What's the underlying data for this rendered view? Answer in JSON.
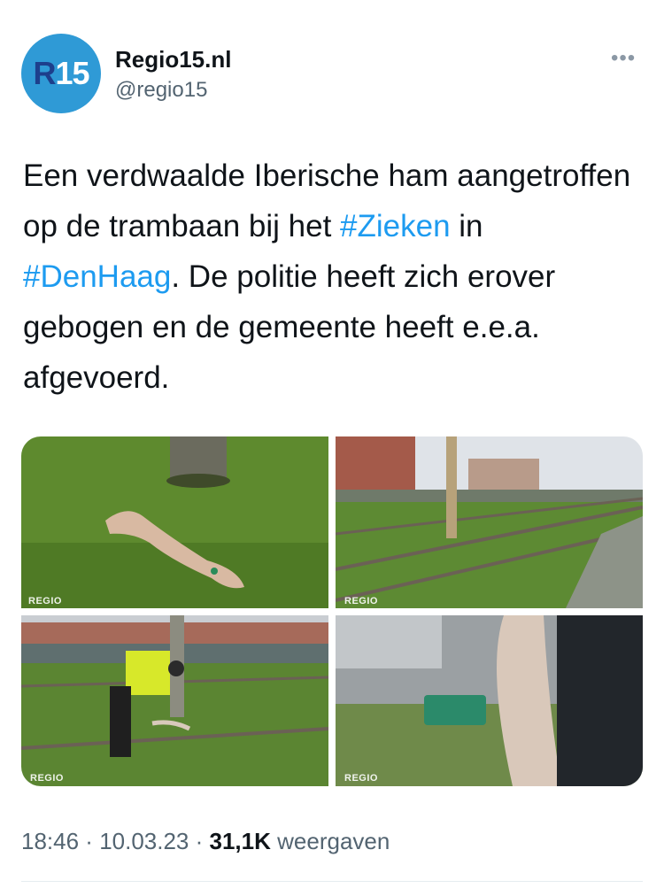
{
  "author": {
    "avatar_text_a": "R",
    "avatar_text_b": "15",
    "name": "Regio15.nl",
    "handle": "@regio15"
  },
  "more_label": "•••",
  "tweet": {
    "part1": "Een verdwaalde Iberische ham aangetroffen op de trambaan bij het ",
    "hashtag1": "#Zieken",
    "part2": " in ",
    "hashtag2": "#DenHaag",
    "part3": ". De politie heeft zich erover gebogen en de gemeente heeft e.e.a. afgevoerd."
  },
  "photos": [
    {
      "watermark": "REGIO",
      "icon": "ham-on-grass-photo"
    },
    {
      "watermark": "REGIO",
      "icon": "tram-tracks-photo"
    },
    {
      "watermark": "REGIO",
      "icon": "police-officer-photo"
    },
    {
      "watermark": "REGIO",
      "icon": "ham-tag-closeup-photo"
    }
  ],
  "meta": {
    "time": "18:46",
    "sep1": " · ",
    "date": "10.03.23",
    "sep2": " · ",
    "views": "31,1K",
    "views_label": " weergaven"
  },
  "colors": {
    "link": "#1d9bf0",
    "secondary": "#536471",
    "avatar_bg": "#2f9ad6"
  }
}
